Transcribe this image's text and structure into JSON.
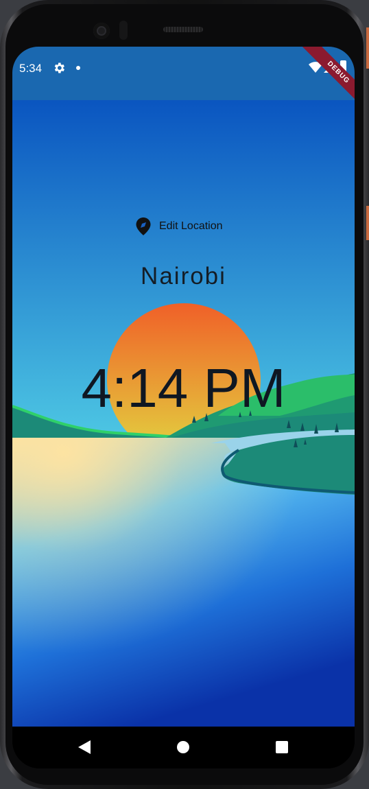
{
  "status_bar": {
    "time": "5:34",
    "icons": [
      "settings-icon",
      "notification-dot-icon",
      "wifi-icon",
      "signal-icon",
      "battery-icon"
    ],
    "debug_banner": "DEBUG"
  },
  "main": {
    "edit_location_label": "Edit Location",
    "edit_location_icon": "location-pin-icon",
    "location_name": "Nairobi",
    "time": "4:14 PM"
  },
  "nav_bar": {
    "icons": [
      "back-icon",
      "home-icon",
      "recents-icon"
    ]
  },
  "colors": {
    "status_bar": "#1a68b0",
    "sky_top": "#0a55c0",
    "sky_bottom": "#4ec8e4",
    "sun_top": "#f06028",
    "sun_bottom": "#e2d440",
    "hill_green": "#2bbe6a",
    "hill_teal": "#1c8a78",
    "water_light": "#fde2a0",
    "water_deep": "#0a32a8"
  }
}
